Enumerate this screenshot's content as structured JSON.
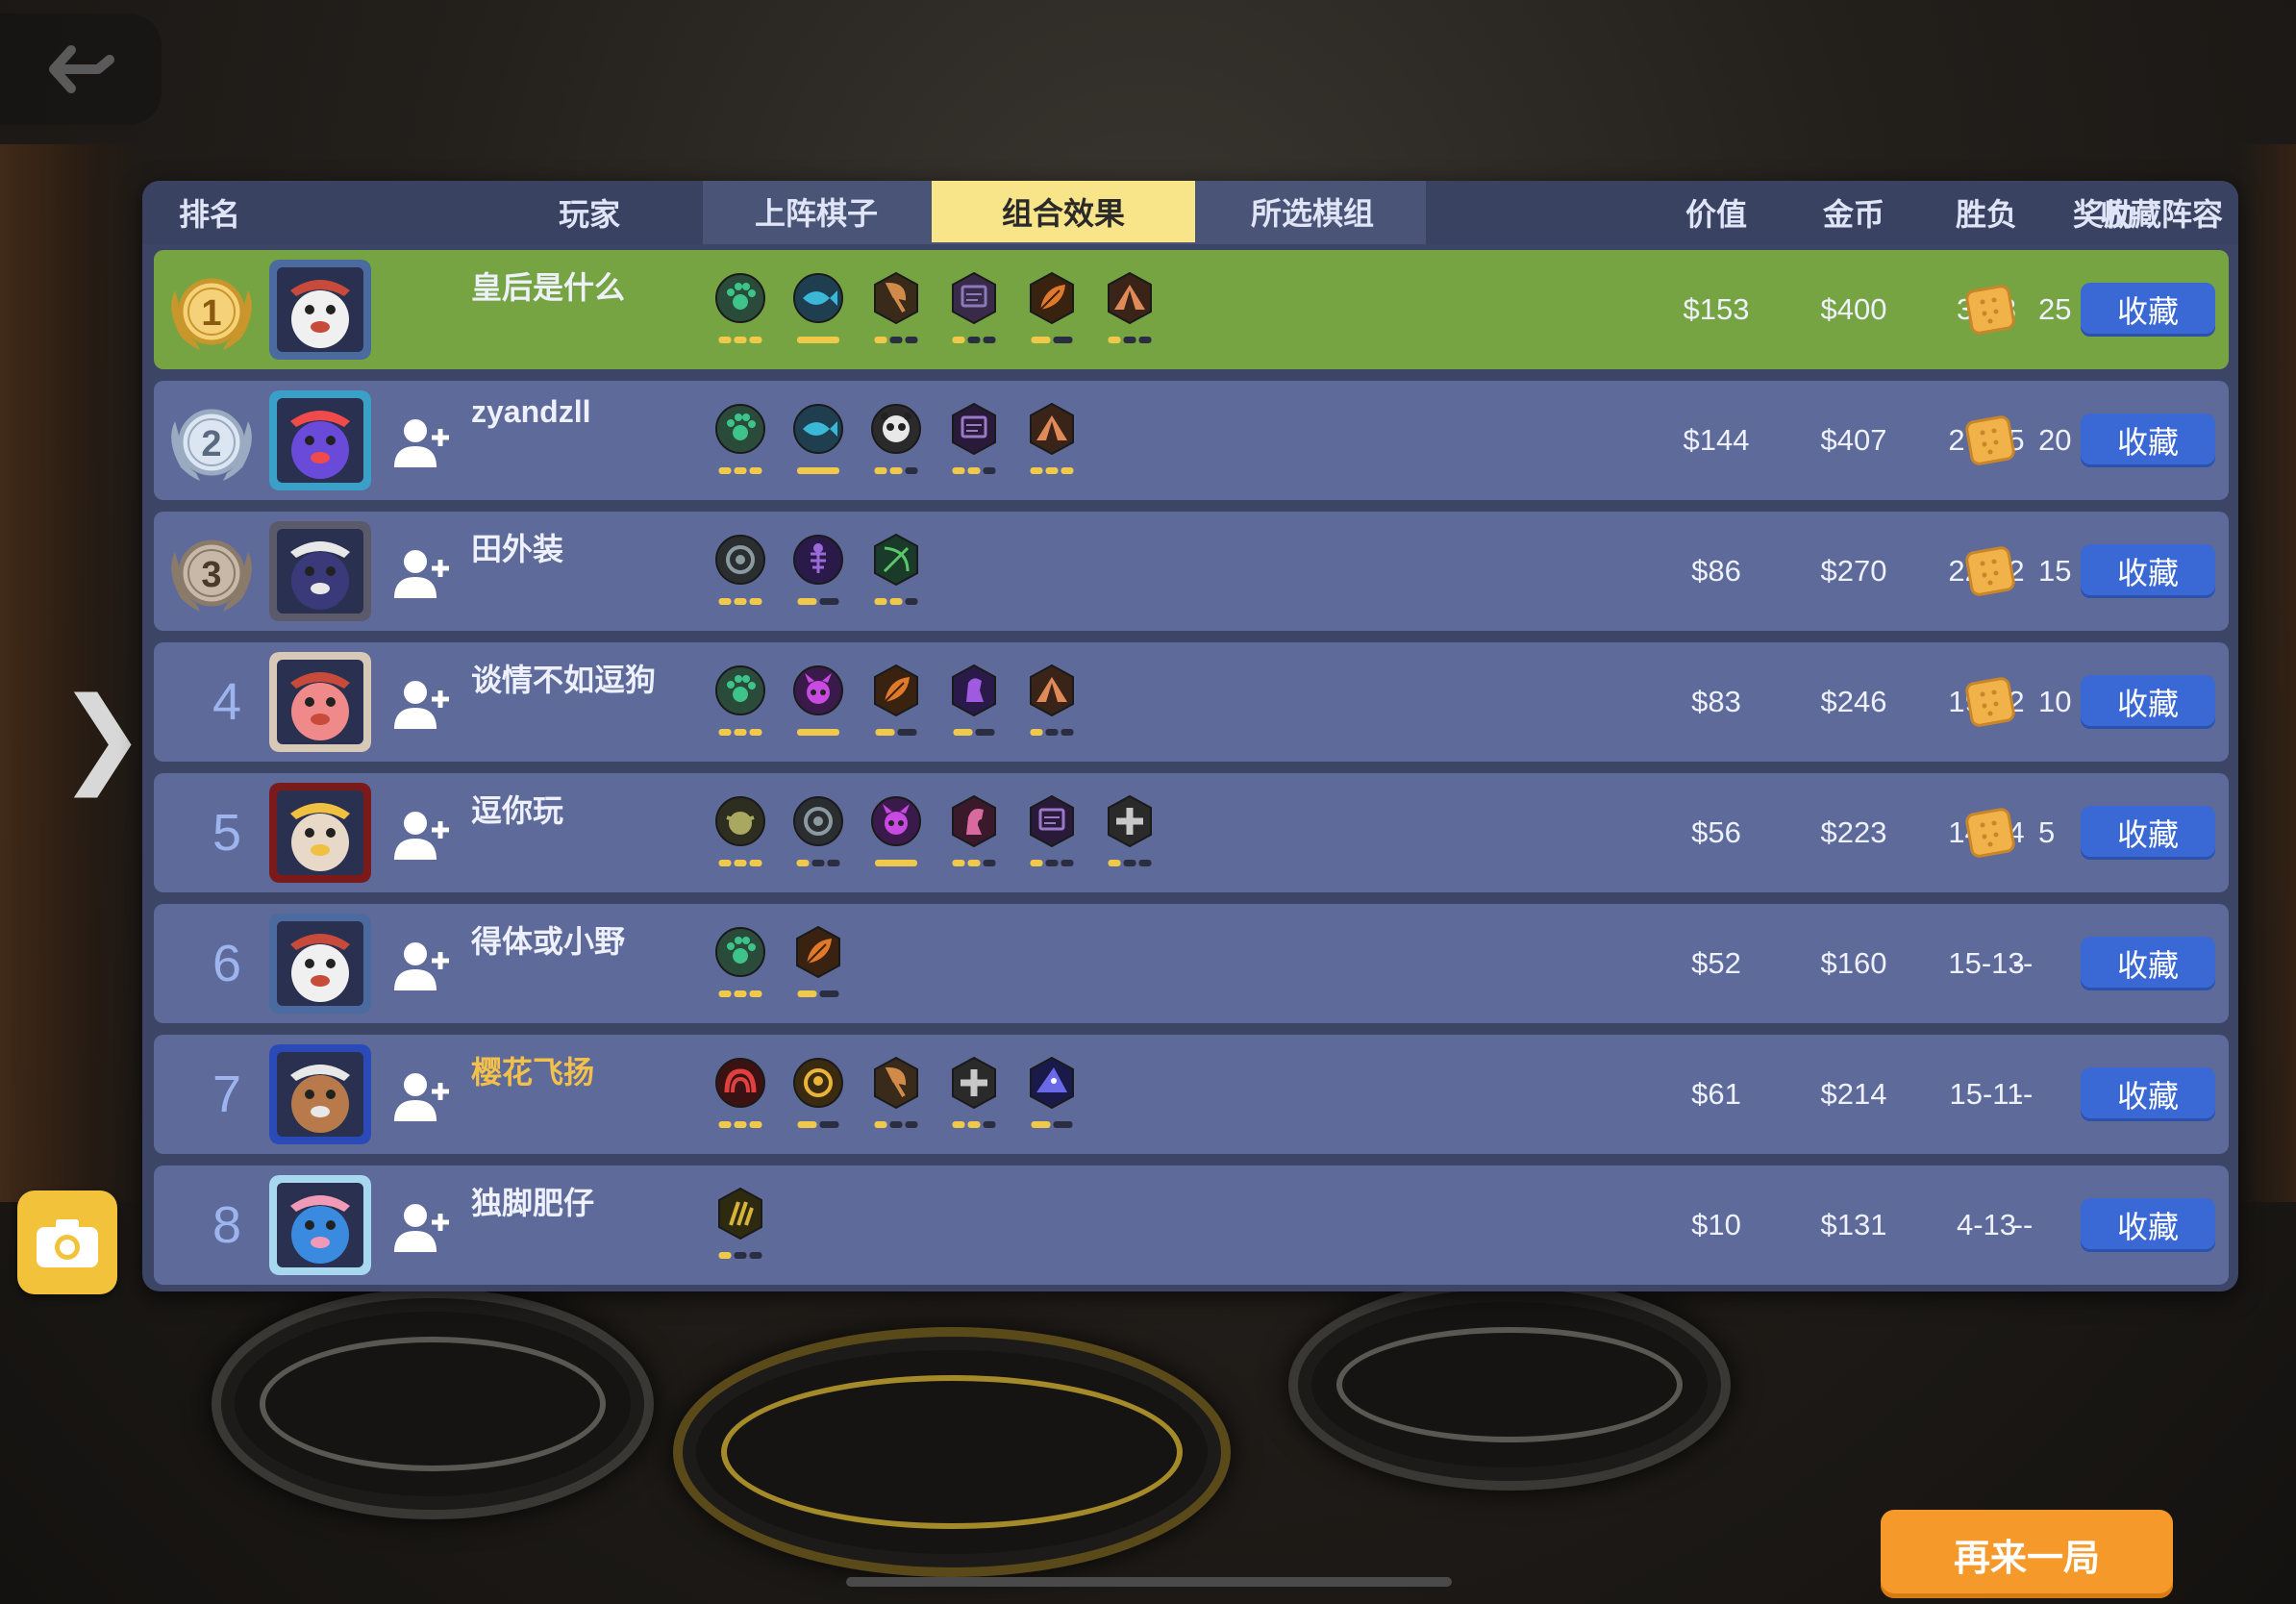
{
  "back_icon": "back-arrow-icon",
  "side_arrow": "❯",
  "camera_icon": "camera-icon",
  "header": {
    "rank": "排名",
    "player": "玩家",
    "tabs": [
      "上阵棋子",
      "组合效果",
      "所选棋组"
    ],
    "active_tab": 1,
    "value": "价值",
    "gold": "金币",
    "winloss": "胜负",
    "reward": "奖励",
    "favorite": "收藏阵容"
  },
  "colors": {
    "panel": "#3d4566",
    "row": "#5e6a9a",
    "first_row": "#76a443",
    "active_tab": "#f8e58a",
    "fav_button": "#3a68d4",
    "again_button": "#f59a2a"
  },
  "rows": [
    {
      "rank": "1",
      "medal": "gold",
      "avatar": "penguin-captain-avatar",
      "show_add": false,
      "name": "皇后是什么",
      "name_color": "white",
      "synergies": [
        {
          "icon": "paw",
          "bg": "#2a4a3a",
          "fg": "#3cc48a",
          "shape": "circle",
          "pips": [
            1,
            1,
            1
          ]
        },
        {
          "icon": "fish",
          "bg": "#1f3f50",
          "fg": "#3bb8d8",
          "shape": "circle",
          "pips": [
            2
          ]
        },
        {
          "icon": "axe",
          "bg": "#3a2a1a",
          "fg": "#d08a4a",
          "shape": "hex",
          "pips": [
            1,
            0,
            0
          ]
        },
        {
          "icon": "tablet",
          "bg": "#3a2a4a",
          "fg": "#8a7ab8",
          "shape": "hex",
          "pips": [
            1,
            0,
            0
          ]
        },
        {
          "icon": "feather",
          "bg": "#3a2210",
          "fg": "#e07a2a",
          "shape": "hex",
          "pips": [
            1,
            0
          ]
        },
        {
          "icon": "tent",
          "bg": "#3a2418",
          "fg": "#e08a5a",
          "shape": "hex",
          "pips": [
            1,
            0,
            0
          ]
        }
      ],
      "value": "$153",
      "gold": "$400",
      "winloss": "34-8",
      "reward": "25",
      "fav": "收藏"
    },
    {
      "rank": "2",
      "medal": "silver",
      "avatar": "shark-avatar",
      "show_add": true,
      "name": "zyandzll",
      "name_color": "white",
      "synergies": [
        {
          "icon": "paw",
          "bg": "#2a4a3a",
          "fg": "#3cc48a",
          "shape": "circle",
          "pips": [
            1,
            1,
            1
          ]
        },
        {
          "icon": "fish",
          "bg": "#1f3f50",
          "fg": "#3bb8d8",
          "shape": "circle",
          "pips": [
            2
          ]
        },
        {
          "icon": "panda",
          "bg": "#2a2a2a",
          "fg": "#e8e8e8",
          "shape": "circle",
          "pips": [
            1,
            1,
            0
          ]
        },
        {
          "icon": "tablet",
          "bg": "#2a1a3a",
          "fg": "#9a7ac8",
          "shape": "hex",
          "pips": [
            1,
            1,
            0
          ]
        },
        {
          "icon": "tent",
          "bg": "#3a2418",
          "fg": "#e08a5a",
          "shape": "hex",
          "pips": [
            1,
            1,
            1
          ]
        }
      ],
      "value": "$144",
      "gold": "$407",
      "winloss": "27-15",
      "reward": "20",
      "fav": "收藏"
    },
    {
      "rank": "3",
      "medal": "bronze",
      "avatar": "wizard-avatar",
      "show_add": true,
      "name": "田外装",
      "name_color": "white",
      "synergies": [
        {
          "icon": "beast",
          "bg": "#2a2e30",
          "fg": "#8a9aa0",
          "shape": "circle",
          "pips": [
            1,
            1,
            1
          ]
        },
        {
          "icon": "skeleton",
          "bg": "#2a1a4a",
          "fg": "#9a6ad8",
          "shape": "circle",
          "pips": [
            1,
            0
          ]
        },
        {
          "icon": "bow",
          "bg": "#1a3a2a",
          "fg": "#5ac86a",
          "shape": "hex",
          "pips": [
            1,
            1,
            0
          ]
        }
      ],
      "value": "$86",
      "gold": "$270",
      "winloss": "22-12",
      "reward": "15",
      "fav": "收藏"
    },
    {
      "rank": "4",
      "medal": "",
      "avatar": "chef-avatar",
      "show_add": true,
      "name": "谈情不如逗狗",
      "name_color": "white",
      "synergies": [
        {
          "icon": "paw",
          "bg": "#2a4a3a",
          "fg": "#3cc48a",
          "shape": "circle",
          "pips": [
            1,
            1,
            1
          ]
        },
        {
          "icon": "demon",
          "bg": "#3a1a4a",
          "fg": "#c84ae0",
          "shape": "circle",
          "pips": [
            2
          ]
        },
        {
          "icon": "feather",
          "bg": "#3a2210",
          "fg": "#e07a2a",
          "shape": "hex",
          "pips": [
            1,
            0
          ]
        },
        {
          "icon": "knight",
          "bg": "#2a1a4a",
          "fg": "#a05ae0",
          "shape": "hex",
          "pips": [
            1,
            0
          ]
        },
        {
          "icon": "tent",
          "bg": "#3a2418",
          "fg": "#e08a5a",
          "shape": "hex",
          "pips": [
            1,
            0,
            0
          ]
        }
      ],
      "value": "$83",
      "gold": "$246",
      "winloss": "19-12",
      "reward": "10",
      "fav": "收藏"
    },
    {
      "rank": "5",
      "medal": "",
      "avatar": "lion-dance-avatar",
      "show_add": true,
      "name": "逗你玩",
      "name_color": "white",
      "synergies": [
        {
          "icon": "goblin",
          "bg": "#2e2e20",
          "fg": "#a8a860",
          "shape": "circle",
          "pips": [
            1,
            1,
            1
          ]
        },
        {
          "icon": "beast",
          "bg": "#2a2e30",
          "fg": "#8a9aa0",
          "shape": "circle",
          "pips": [
            1,
            0,
            0
          ]
        },
        {
          "icon": "demon",
          "bg": "#3a1a4a",
          "fg": "#c84ae0",
          "shape": "circle",
          "pips": [
            2
          ]
        },
        {
          "icon": "horse",
          "bg": "#3a1a2a",
          "fg": "#d86aa0",
          "shape": "hex",
          "pips": [
            1,
            1,
            0
          ]
        },
        {
          "icon": "tablet",
          "bg": "#2a1a3a",
          "fg": "#9a7ac8",
          "shape": "hex",
          "pips": [
            1,
            0,
            0
          ]
        },
        {
          "icon": "cross",
          "bg": "#2a2a2a",
          "fg": "#c8c8c8",
          "shape": "hex",
          "pips": [
            1,
            0,
            0
          ]
        }
      ],
      "value": "$56",
      "gold": "$223",
      "winloss": "14-14",
      "reward": "5",
      "fav": "收藏"
    },
    {
      "rank": "6",
      "medal": "",
      "avatar": "penguin-captain-avatar",
      "show_add": true,
      "name": "得体或小野",
      "name_color": "white",
      "synergies": [
        {
          "icon": "paw",
          "bg": "#2a4a3a",
          "fg": "#3cc48a",
          "shape": "circle",
          "pips": [
            1,
            1,
            1
          ]
        },
        {
          "icon": "feather",
          "bg": "#3a2210",
          "fg": "#e07a2a",
          "shape": "hex",
          "pips": [
            1,
            0
          ]
        }
      ],
      "value": "$52",
      "gold": "$160",
      "winloss": "15-13",
      "reward": "--",
      "fav": "收藏"
    },
    {
      "rank": "7",
      "medal": "",
      "avatar": "warrior-avatar",
      "show_add": true,
      "name": "樱花飞扬",
      "name_color": "gold",
      "synergies": [
        {
          "icon": "wave",
          "bg": "#3a1212",
          "fg": "#e04040",
          "shape": "circle",
          "pips": [
            1,
            1,
            1
          ]
        },
        {
          "icon": "mask",
          "bg": "#3a2a10",
          "fg": "#e8b43a",
          "shape": "circle",
          "pips": [
            1,
            0
          ]
        },
        {
          "icon": "axe",
          "bg": "#3a2a1a",
          "fg": "#d08a4a",
          "shape": "hex",
          "pips": [
            1,
            0,
            0
          ]
        },
        {
          "icon": "cross",
          "bg": "#2a2a2a",
          "fg": "#c8c8c8",
          "shape": "hex",
          "pips": [
            1,
            1,
            0
          ]
        },
        {
          "icon": "hat",
          "bg": "#1a1a4a",
          "fg": "#6a6ae8",
          "shape": "hex",
          "pips": [
            1,
            0
          ]
        }
      ],
      "value": "$61",
      "gold": "$214",
      "winloss": "15-11",
      "reward": "--",
      "fav": "收藏"
    },
    {
      "rank": "8",
      "medal": "",
      "avatar": "bird-avatar",
      "show_add": true,
      "name": "独脚肥仔",
      "name_color": "white",
      "synergies": [
        {
          "icon": "claw",
          "bg": "#2e2a10",
          "fg": "#d8b43a",
          "shape": "hex",
          "pips": [
            1,
            0,
            0
          ]
        }
      ],
      "value": "$10",
      "gold": "$131",
      "winloss": "4-13",
      "reward": "--",
      "fav": "收藏"
    }
  ],
  "play_again": "再来一局"
}
